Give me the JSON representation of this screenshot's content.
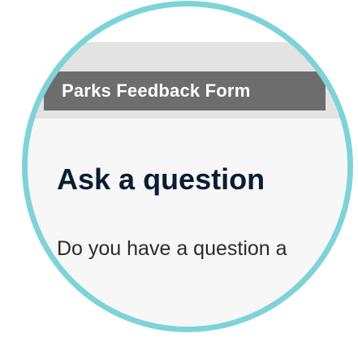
{
  "form": {
    "tab_title": "Parks Feedback Form",
    "heading": "Ask a question",
    "intro_text": "Do you have a question a"
  },
  "colors": {
    "frame_ring": "#7ed3d8",
    "tab_background": "#6d6d6d",
    "heading_text": "#0b1d33",
    "page_band": "#e3e3e3"
  }
}
